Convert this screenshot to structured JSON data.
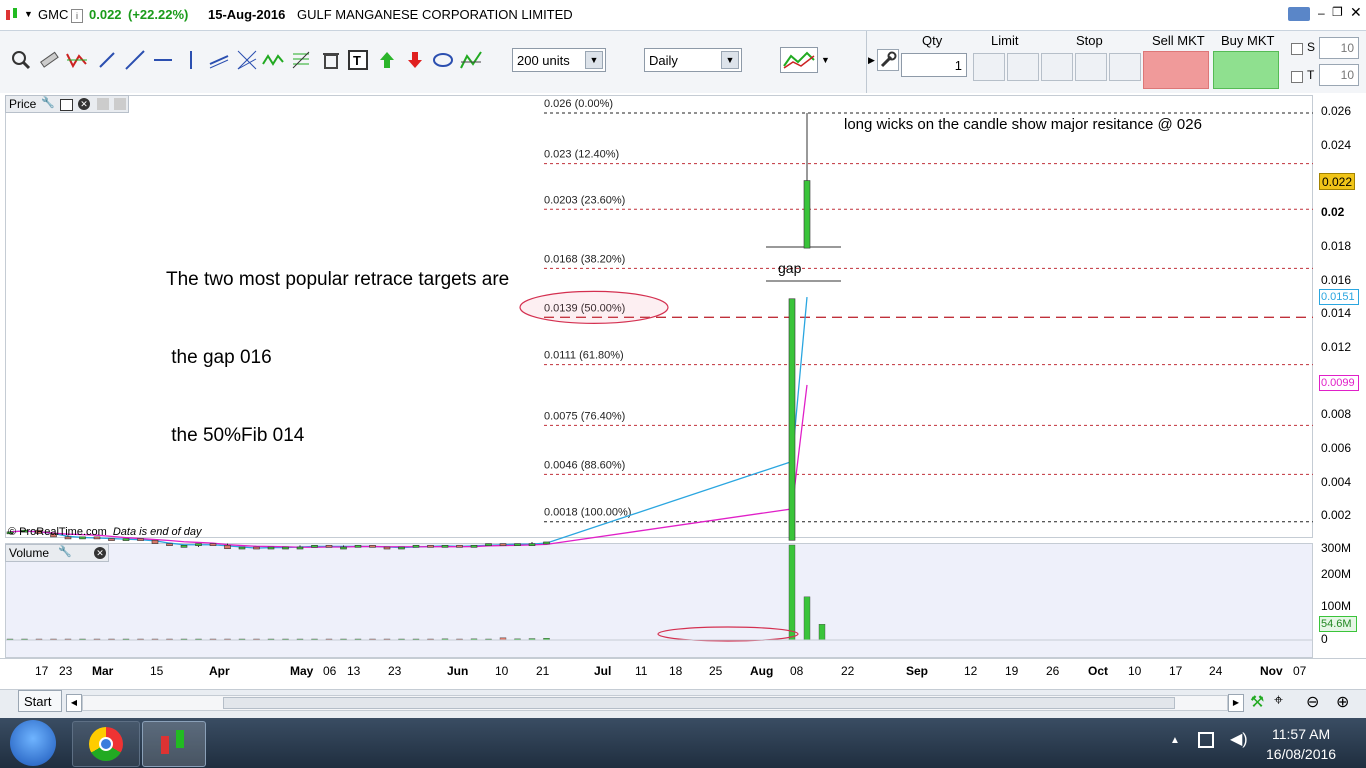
{
  "title_bar": {
    "symbol": "GMC",
    "price": "0.022",
    "change": "(+22.22%)",
    "date": "15-Aug-2016",
    "company": "GULF MANGANESE CORPORATION LIMITED",
    "up_color": "#1a9b1a"
  },
  "toolbar": {
    "units_value": "200 units",
    "period_value": "Daily"
  },
  "order_panel": {
    "qty_label": "Qty",
    "qty_value": "1",
    "limit_label": "Limit",
    "stop_label": "Stop",
    "sell_label": "Sell MKT",
    "buy_label": "Buy MKT",
    "s_label": "S",
    "t_label": "T",
    "s_value": "10",
    "t_value": "10"
  },
  "price_panel": {
    "label": "Price",
    "copyright": "© ProRealTime.com",
    "data_note": "Data is end of day"
  },
  "volume_panel": {
    "label": "Volume"
  },
  "annotations": {
    "text_block": [
      "The two most popular retrace targets are",
      " the gap 016",
      " the 50%Fib 014"
    ],
    "wick_note": "long wicks on the candle show major resitance @ 026",
    "gap_label": "gap"
  },
  "price_axis": {
    "ticks": [
      "0.026",
      "0.024",
      "0.022",
      "0.02",
      "0.018",
      "0.016",
      "0.014",
      "0.012",
      "0.01",
      "0.008",
      "0.006",
      "0.004",
      "0.002"
    ],
    "current_price": "0.022",
    "ma_fast": "0.0151",
    "ma_slow": "0.0099"
  },
  "volume_axis": {
    "ticks": [
      "300M",
      "200M",
      "100M",
      "0"
    ],
    "current": "54.6M"
  },
  "fib_levels": [
    {
      "value": 0.026,
      "label": "0.026 (0.00%)"
    },
    {
      "value": 0.023,
      "label": "0.023 (12.40%)"
    },
    {
      "value": 0.0203,
      "label": "0.0203 (23.60%)"
    },
    {
      "value": 0.0168,
      "label": "0.0168 (38.20%)"
    },
    {
      "value": 0.0139,
      "label": "0.0139 (50.00%)"
    },
    {
      "value": 0.0111,
      "label": "0.0111 (61.80%)"
    },
    {
      "value": 0.0075,
      "label": "0.0075 (76.40%)"
    },
    {
      "value": 0.0046,
      "label": "0.0046 (88.60%)"
    },
    {
      "value": 0.0018,
      "label": "0.0018 (100.00%)"
    }
  ],
  "x_axis": [
    "17",
    "23",
    "Mar",
    "15",
    "Apr",
    "May",
    "06",
    "13",
    "23",
    "Jun",
    "10",
    "21",
    "Jul",
    "11",
    "18",
    "25",
    "Aug",
    "08",
    "22",
    "Sep",
    "12",
    "19",
    "26",
    "Oct",
    "10",
    "17",
    "24",
    "Nov",
    "07"
  ],
  "start_button": "Start",
  "taskbar": {
    "time": "11:57 AM",
    "date": "16/08/2016"
  },
  "colors": {
    "bull": "#3ac43a",
    "bear": "#d9786a",
    "ma_fast": "#2aa6e0",
    "ma_slow": "#e020c8",
    "fib": "#c0303a",
    "price_badge": "#f0c418"
  },
  "chart_data": {
    "type": "candlestick",
    "x_unit": "trading day index",
    "ohlc": [
      [
        0.0012,
        0.0012,
        0.0012,
        0.0012
      ],
      [
        0.0012,
        0.0013,
        0.0012,
        0.0013
      ],
      [
        0.0013,
        0.0013,
        0.0011,
        0.0011
      ],
      [
        0.0011,
        0.0011,
        0.0009,
        0.0009
      ],
      [
        0.0009,
        0.001,
        0.0008,
        0.0008
      ],
      [
        0.0008,
        0.0009,
        0.0008,
        0.0009
      ],
      [
        0.0009,
        0.0009,
        0.0008,
        0.0008
      ],
      [
        0.0008,
        0.0008,
        0.0007,
        0.0007
      ],
      [
        0.0007,
        0.0008,
        0.0007,
        0.0008
      ],
      [
        0.0008,
        0.0008,
        0.0007,
        0.0007
      ],
      [
        0.0007,
        0.0007,
        0.0005,
        0.0005
      ],
      [
        0.0005,
        0.0005,
        0.0004,
        0.0004
      ],
      [
        0.0004,
        0.0004,
        0.0004,
        0.0004
      ],
      [
        0.0004,
        0.0005,
        0.0003,
        0.0005
      ],
      [
        0.0005,
        0.0005,
        0.0004,
        0.0004
      ],
      [
        0.0004,
        0.0005,
        0.0002,
        0.0002
      ],
      [
        0.0002,
        0.0003,
        0.0002,
        0.0003
      ],
      [
        0.0003,
        0.0003,
        0.0002,
        0.0002
      ],
      [
        0.0002,
        0.0003,
        0.0002,
        0.0003
      ],
      [
        0.0003,
        0.0003,
        0.0003,
        0.0003
      ],
      [
        0.0003,
        0.0004,
        0.0003,
        0.0003
      ],
      [
        0.0003,
        0.0004,
        0.0003,
        0.0004
      ],
      [
        0.0004,
        0.0004,
        0.0003,
        0.0003
      ],
      [
        0.0003,
        0.0004,
        0.0003,
        0.0003
      ],
      [
        0.0003,
        0.0004,
        0.0003,
        0.0004
      ],
      [
        0.0004,
        0.0004,
        0.0003,
        0.0003
      ],
      [
        0.0003,
        0.0003,
        0.0002,
        0.0002
      ],
      [
        0.0002,
        0.0003,
        0.0002,
        0.0003
      ],
      [
        0.0003,
        0.0004,
        0.0003,
        0.0004
      ],
      [
        0.0004,
        0.0004,
        0.0003,
        0.0003
      ],
      [
        0.0003,
        0.0004,
        0.0003,
        0.0004
      ],
      [
        0.0004,
        0.0004,
        0.0003,
        0.0003
      ],
      [
        0.0003,
        0.0004,
        0.0003,
        0.0004
      ],
      [
        0.0004,
        0.0005,
        0.0004,
        0.0005
      ],
      [
        0.0005,
        0.0005,
        0.0004,
        0.0004
      ],
      [
        0.0004,
        0.0005,
        0.0004,
        0.0005
      ],
      [
        0.0005,
        0.0006,
        0.0005,
        0.0005
      ],
      [
        0.0005,
        0.0006,
        0.0005,
        0.0006
      ],
      [
        0.0007,
        0.015,
        0.0068,
        0.015
      ],
      [
        0.018,
        0.026,
        0.018,
        0.022
      ]
    ],
    "volume_millions": [
      2,
      2,
      2,
      2,
      2,
      2,
      2,
      2,
      2,
      2,
      2,
      3,
      2,
      2,
      3,
      2,
      2,
      2,
      3,
      2,
      2,
      2,
      3,
      2,
      2,
      2,
      3,
      2,
      2,
      3,
      4,
      3,
      4,
      3,
      8,
      4,
      5,
      6,
      330,
      150,
      54.6
    ],
    "ma_fast_last": 0.0151,
    "ma_slow_last": 0.0099,
    "ylim": [
      0.0015,
      0.0265
    ]
  }
}
